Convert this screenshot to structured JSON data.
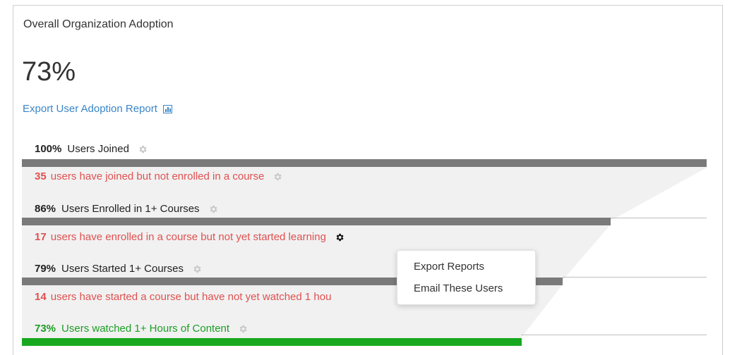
{
  "summary": {
    "title": "Overall Organization Adoption",
    "value": "73%",
    "export_label": "Export User Adoption Report",
    "export_icon": "bar-chart-report-icon"
  },
  "funnel": [
    {
      "percent": "100%",
      "label": "Users Joined",
      "fraction": 1.0,
      "color": "#7a7a7a",
      "note_count": "35",
      "note_text": "users have joined but not enrolled in a course"
    },
    {
      "percent": "86%",
      "label": "Users Enrolled in 1+ Courses",
      "fraction": 0.86,
      "color": "#7a7a7a",
      "note_count": "17",
      "note_text": "users have enrolled in a course but not yet started learning"
    },
    {
      "percent": "79%",
      "label": "Users Started 1+ Courses",
      "fraction": 0.79,
      "color": "#7a7a7a",
      "note_count": "14",
      "note_text": "users have started a course but have not yet watched 1 hou"
    },
    {
      "percent": "73%",
      "label": "Users watched 1+ Hours of Content",
      "fraction": 0.73,
      "color": "#17a81f"
    }
  ],
  "context_menu": {
    "items": [
      "Export Reports",
      "Email These Users"
    ]
  },
  "colors": {
    "accent_link": "#3a86c8",
    "warning_text": "#e05050",
    "success": "#1a9e23",
    "bar_gray": "#7a7a7a"
  },
  "icons": {
    "gear": "gear-icon"
  }
}
